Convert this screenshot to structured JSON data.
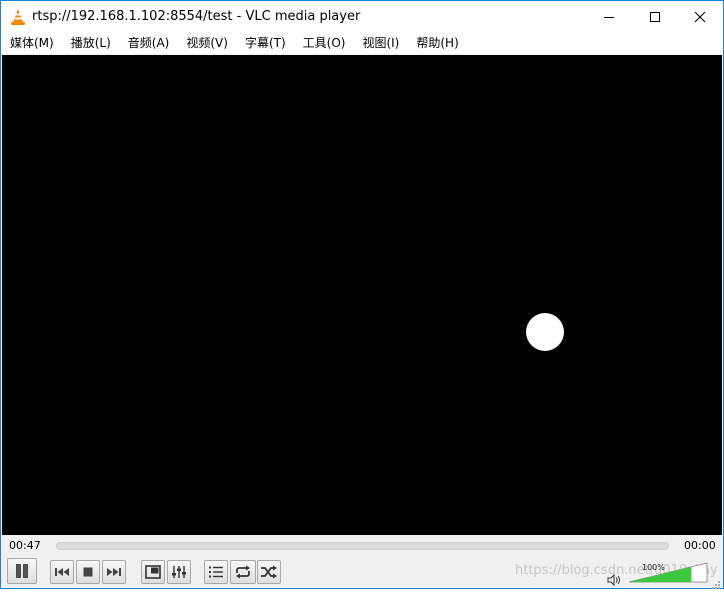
{
  "window": {
    "title": "rtsp://192.168.1.102:8554/test - VLC media player"
  },
  "menu": {
    "items": [
      {
        "label": "媒体(M)"
      },
      {
        "label": "播放(L)"
      },
      {
        "label": "音频(A)"
      },
      {
        "label": "视频(V)"
      },
      {
        "label": "字幕(T)"
      },
      {
        "label": "工具(O)"
      },
      {
        "label": "视图(I)"
      },
      {
        "label": "帮助(H)"
      }
    ]
  },
  "player": {
    "elapsed": "00:47",
    "total": "00:00",
    "seek_progress": 0
  },
  "volume": {
    "label": "100%",
    "level": 0.8
  },
  "watermark": "https://blog.csdn.net/u010vijay",
  "colors": {
    "video_bg": "#000000",
    "volume_fill": "#3cc83c",
    "accent": "#1883d7"
  },
  "icons": {
    "app": "vlc-cone-icon",
    "pause": "pause-icon",
    "prev": "previous-icon",
    "stop": "stop-icon",
    "next": "next-icon",
    "fullscreen": "fullscreen-icon",
    "eq": "extended-settings-icon",
    "playlist": "playlist-icon",
    "loop": "loop-icon",
    "shuffle": "shuffle-icon",
    "speaker": "speaker-icon"
  }
}
